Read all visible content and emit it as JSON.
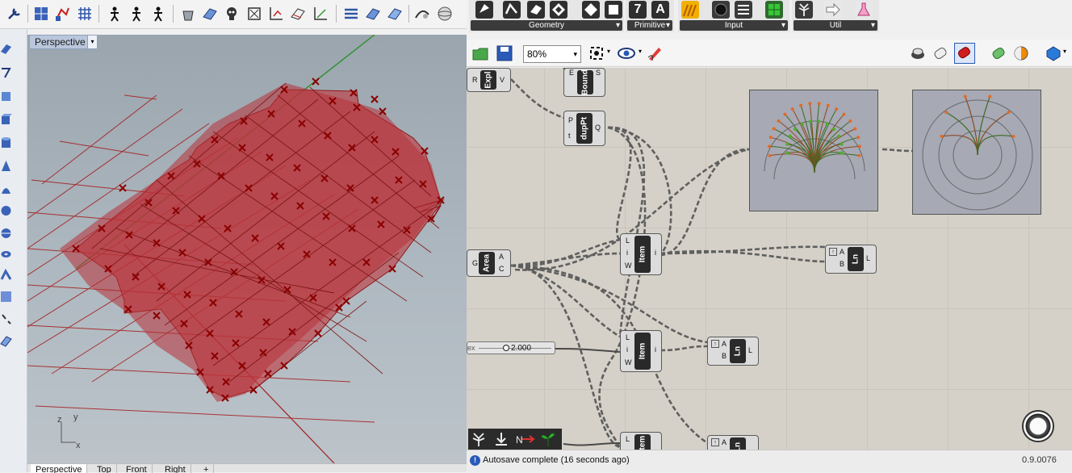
{
  "rhino": {
    "viewport": {
      "label": "Perspective",
      "dropdown_glyph": "▾"
    },
    "view_tabs": [
      "Perspective",
      "Top",
      "Front",
      "Right"
    ],
    "add_tab_glyph": "+",
    "axis_labels": {
      "z": "z",
      "y": "y",
      "x": "x"
    }
  },
  "grasshopper": {
    "ribbon_groups": [
      {
        "label": "Geometry",
        "arrow": "▾"
      },
      {
        "label": "Primitive",
        "arrow": "▾"
      },
      {
        "label": "Input",
        "arrow": "▾"
      },
      {
        "label": "Util",
        "arrow": "▾"
      }
    ],
    "primitive_glyphs": [
      "7",
      "A"
    ],
    "zoom": "80%",
    "components": {
      "explode": {
        "name": "Expl",
        "inputs": [
          "R"
        ],
        "outputs": [
          "V"
        ]
      },
      "bounds": {
        "name": "Bound",
        "inputs": [
          "E"
        ],
        "outputs": [
          "S"
        ]
      },
      "dup_pt": {
        "name": "dupPt",
        "inputs": [
          "P",
          "t"
        ],
        "outputs": [
          "Q"
        ]
      },
      "area": {
        "name": "Area",
        "inputs": [
          "G"
        ],
        "outputs": [
          "A",
          "C"
        ]
      },
      "item_1": {
        "name": "Item",
        "inputs": [
          "L",
          "i",
          "W"
        ],
        "outputs": [
          "i"
        ]
      },
      "item_2": {
        "name": "Item",
        "inputs": [
          "L",
          "i",
          "W"
        ],
        "outputs": [
          "i"
        ]
      },
      "item_3": {
        "name": "Item",
        "inputs": [
          "L"
        ],
        "outputs": []
      },
      "line_1": {
        "name": "Ln",
        "inputs": [
          "A",
          "B"
        ],
        "outputs": [
          "L"
        ]
      },
      "line_2": {
        "name": "Ln",
        "inputs": [
          "A",
          "B"
        ],
        "outputs": [
          "L"
        ]
      },
      "line_3": {
        "name": "Ln",
        "inputs": [
          "A"
        ],
        "outputs": []
      }
    },
    "slider": {
      "prefix": "ex",
      "value": "2.000"
    },
    "status": {
      "message": "Autosave complete (16 seconds ago)",
      "version": "0.9.0076"
    },
    "colors": {
      "canvas": "#d5d1c8",
      "mesh_fill": "#c0393f",
      "node_dark": "#2a2a2a",
      "accent_red": "#c00000"
    }
  }
}
